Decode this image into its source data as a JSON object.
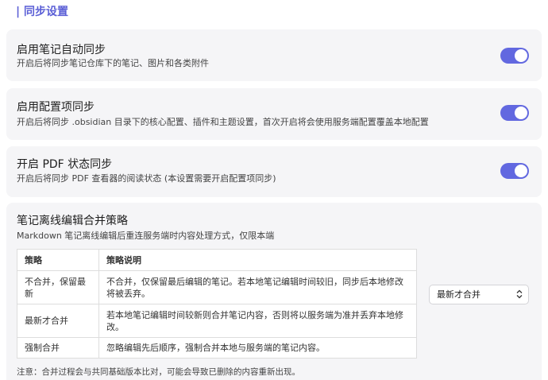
{
  "section": {
    "title": "| 同步设置"
  },
  "settings": [
    {
      "title": "启用笔记自动同步",
      "description": "开启后将同步笔记仓库下的笔记、图片和各类附件",
      "enabled": true
    },
    {
      "title": "启用配置项同步",
      "description": "开启后将同步 .obsidian 目录下的核心配置、插件和主题设置，首次开启将会使用服务端配置覆盖本地配置",
      "enabled": true
    },
    {
      "title": "开启 PDF 状态同步",
      "description": "开启后将同步 PDF 查看器的阅读状态 (本设置需要开启配置项同步)",
      "enabled": true
    }
  ],
  "merge_strategy": {
    "title": "笔记离线编辑合并策略",
    "description": "Markdown 笔记离线编辑后重连服务端时内容处理方式，仅限本端",
    "table": {
      "headers": [
        "策略",
        "策略说明"
      ],
      "rows": [
        [
          "不合并，保留最新",
          "不合并，仅保留最后编辑的笔记。若本地笔记编辑时间较旧，同步后本地修改将被丢弃。"
        ],
        [
          "最新才合并",
          "若本地笔记编辑时间较新则合并笔记内容，否则将以服务端为准并丢弃本地修改。"
        ],
        [
          "强制合并",
          "忽略编辑先后顺序，强制合并本地与服务端的笔记内容。"
        ]
      ]
    },
    "selected": "最新才合并",
    "chevron_icon": "updown-chevron-icon",
    "note": "注意：合并过程会与共同基础版本比对，可能会导致已删除的内容重新出现。"
  },
  "colors": {
    "accent": "#6268e0",
    "card_background": "#f5f5f7",
    "section_title": "#5b5fd6"
  }
}
